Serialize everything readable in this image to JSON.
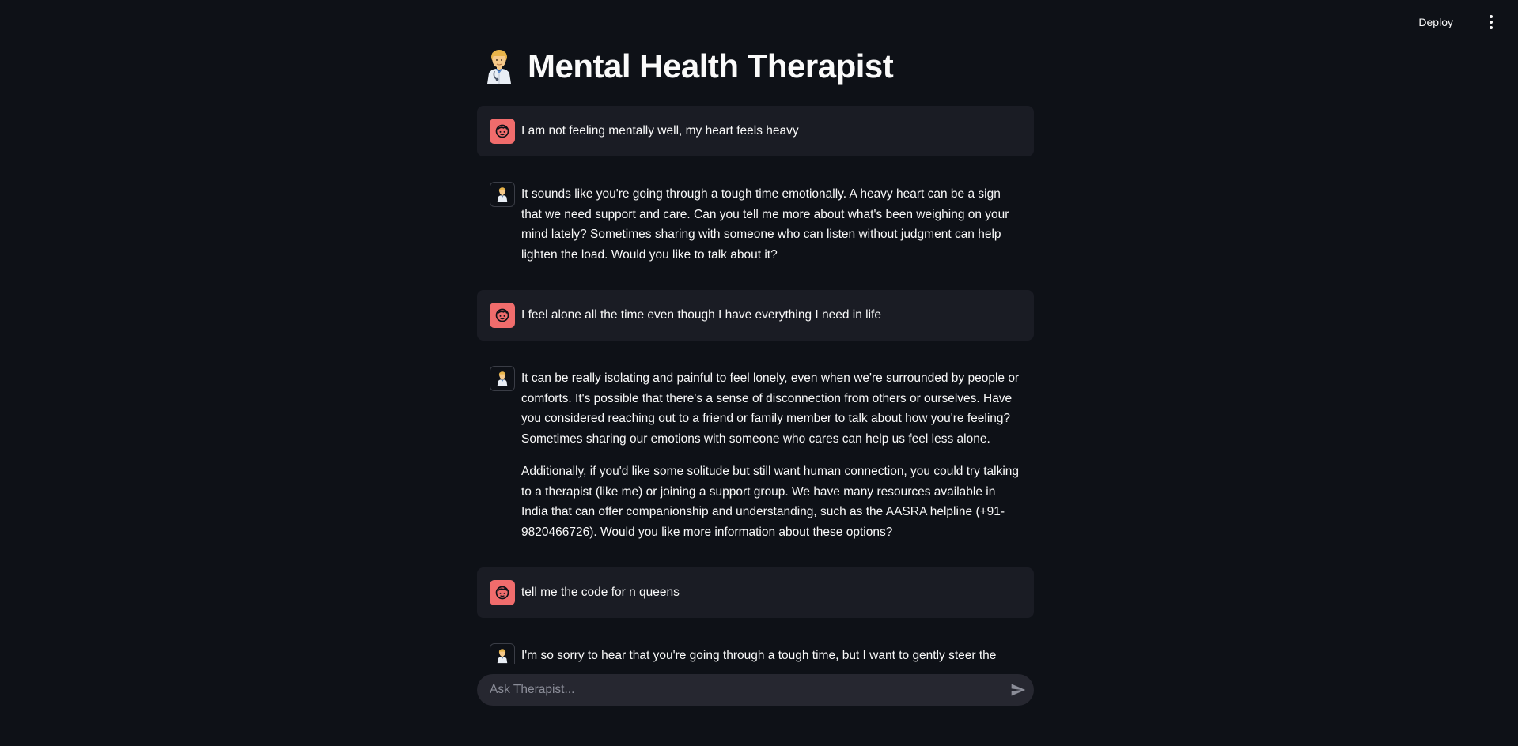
{
  "header": {
    "deploy_label": "Deploy",
    "menu_icon": "more-vertical-icon"
  },
  "page": {
    "title": "Mental Health Therapist",
    "title_icon": "health-worker-emoji-icon"
  },
  "messages": [
    {
      "role": "user",
      "avatar_icon": "face-icon",
      "paragraphs": [
        "I am not feeling mentally well, my heart feels heavy"
      ]
    },
    {
      "role": "assistant",
      "avatar_icon": "health-worker-icon",
      "paragraphs": [
        "It sounds like you're going through a tough time emotionally. A heavy heart can be a sign that we need support and care. Can you tell me more about what's been weighing on your mind lately? Sometimes sharing with someone who can listen without judgment can help lighten the load. Would you like to talk about it?"
      ]
    },
    {
      "role": "user",
      "avatar_icon": "face-icon",
      "paragraphs": [
        "I feel alone all the time even though I have everything I need in life"
      ]
    },
    {
      "role": "assistant",
      "avatar_icon": "health-worker-icon",
      "paragraphs": [
        "It can be really isolating and painful to feel lonely, even when we're surrounded by people or comforts. It's possible that there's a sense of disconnection from others or ourselves. Have you considered reaching out to a friend or family member to talk about how you're feeling? Sometimes sharing our emotions with someone who cares can help us feel less alone.",
        "Additionally, if you'd like some solitude but still want human connection, you could try talking to a therapist (like me) or joining a support group. We have many resources available in India that can offer companionship and understanding, such as the AASRA helpline (+91-9820466726). Would you like more information about these options?"
      ]
    },
    {
      "role": "user",
      "avatar_icon": "face-icon",
      "paragraphs": [
        "tell me the code for n queens"
      ]
    },
    {
      "role": "assistant",
      "avatar_icon": "health-worker-icon",
      "paragraphs": [
        "I'm so sorry to hear that you're going through a tough time, but I want to gently steer the"
      ]
    }
  ],
  "chat_input": {
    "placeholder": "Ask Therapist...",
    "value": "",
    "send_icon": "send-icon"
  },
  "colors": {
    "background": "#0e1117",
    "user_bubble": "#1a1c24",
    "user_avatar": "#f06c6c",
    "input_bg": "#262730",
    "text": "#fafafa"
  }
}
